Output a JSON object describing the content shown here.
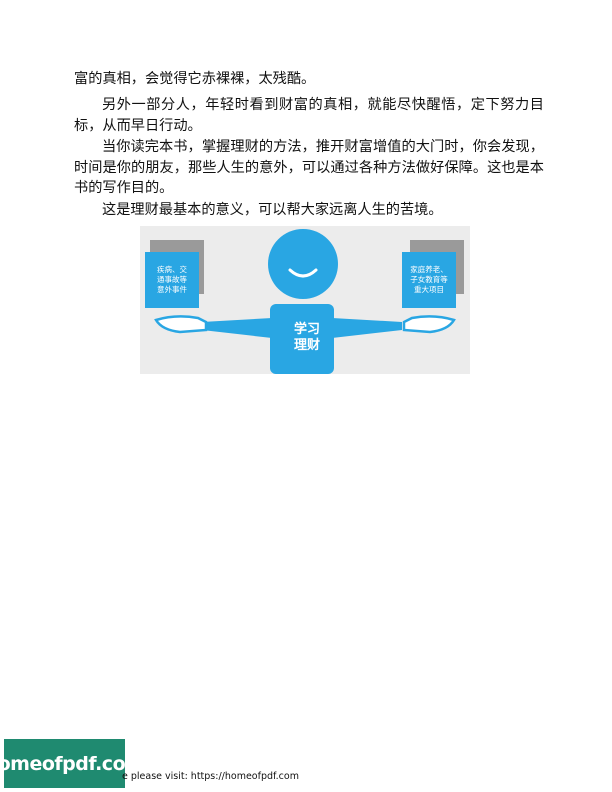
{
  "paragraphs": [
    "富的真相，会觉得它赤裸裸，太残酷。",
    "另外一部分人，年轻时看到财富的真相，就能尽快醒悟，定下努力目标，从而早日行动。",
    "当你读完本书，掌握理财的方法，推开财富增值的大门时，你会发现，时间是你的朋友，那些人生的意外，可以通过各种方法做好保障。这也是本书的写作目的。",
    "这是理财最基本的意义，可以帮大家远离人生的苦境。"
  ],
  "figure": {
    "left_card": [
      "疾病、交",
      "通事故等",
      "意外事件"
    ],
    "right_card": [
      "家庭养老、",
      "子女教育等",
      "重大项目"
    ],
    "badge": [
      "学习",
      "理财"
    ],
    "colors": {
      "blue": "#29a6e3",
      "shadow": "#9a9a9a",
      "background": "#ececec"
    }
  },
  "footer": {
    "logo": "homeofpdf.com",
    "text": "e please visit: https://homeofpdf.com"
  }
}
